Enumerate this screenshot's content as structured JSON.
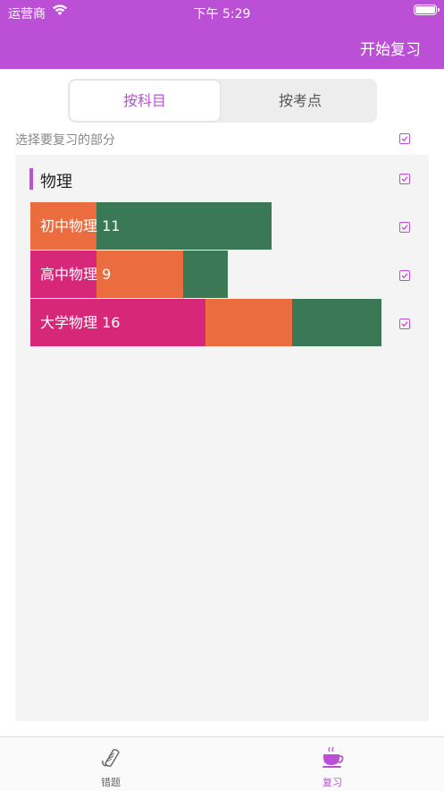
{
  "status_bar": {
    "carrier": "运营商",
    "time": "下午 5:29"
  },
  "nav": {
    "start_review": "开始复习"
  },
  "segments": {
    "by_subject": "按科目",
    "by_point": "按考点"
  },
  "select_label": "选择要复习的部分",
  "subject": {
    "title": "物理"
  },
  "rows": [
    {
      "label": "初中物理 11",
      "segments": [
        {
          "color": "#ea6c3f",
          "value": 0.187
        },
        {
          "color": "#3a7856",
          "value": 0.497
        }
      ]
    },
    {
      "label": "高中物理 9",
      "segments": [
        {
          "color": "#d72779",
          "value": 0.187
        },
        {
          "color": "#ea6c3f",
          "value": 0.247
        },
        {
          "color": "#3a7856",
          "value": 0.127
        }
      ]
    },
    {
      "label": "大学物理 16",
      "segments": [
        {
          "color": "#d72779",
          "value": 0.497
        },
        {
          "color": "#ea6c3f",
          "value": 0.247
        },
        {
          "color": "#3a7856",
          "value": 0.254
        }
      ]
    }
  ],
  "tabs": {
    "wrong": "错题",
    "review": "复习"
  },
  "colors": {
    "accent": "#bb50d6"
  }
}
